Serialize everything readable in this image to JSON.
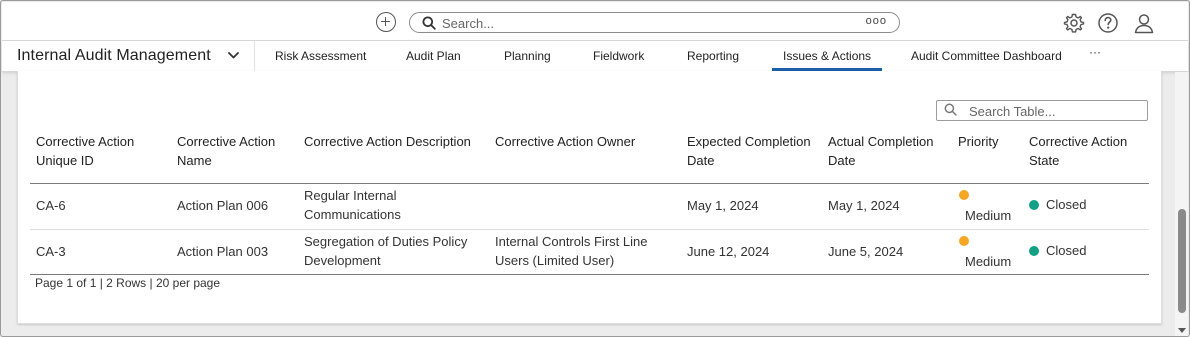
{
  "global_search": {
    "placeholder": "Search...",
    "more": "ooo"
  },
  "nav": {
    "app_name": "Internal Audit Management",
    "tabs": [
      {
        "label": "Risk Assessment"
      },
      {
        "label": "Audit Plan"
      },
      {
        "label": "Planning"
      },
      {
        "label": "Fieldwork"
      },
      {
        "label": "Reporting"
      },
      {
        "label": "Issues & Actions",
        "active": true
      },
      {
        "label": "Audit Committee Dashboard"
      }
    ],
    "more": "···"
  },
  "table": {
    "search_placeholder": "Search Table...",
    "headers": [
      "Corrective Action\nUnique ID",
      "Corrective Action\nName",
      "Corrective Action Description",
      "Corrective Action Owner",
      "Expected Completion\nDate",
      "Actual Completion\nDate",
      "Priority",
      "Corrective Action\nState"
    ],
    "rows": [
      {
        "id": "CA-6",
        "name": "Action Plan 006",
        "description": "Regular Internal\nCommunications",
        "owner": "",
        "expected": "May 1, 2024",
        "actual": "May 1, 2024",
        "priority": "Medium",
        "state": "Closed"
      },
      {
        "id": "CA-3",
        "name": "Action Plan 003",
        "description": "Segregation of Duties Policy\nDevelopment",
        "owner": "Internal Controls First Line\nUsers (Limited User)",
        "expected": "June 12, 2024",
        "actual": "June 5, 2024",
        "priority": "Medium",
        "state": "Closed"
      }
    ],
    "pager": "Page 1 of 1 | 2 Rows | 20 per page"
  },
  "colors": {
    "priority_medium": "#f5a623",
    "state_closed": "#14a085",
    "active_tab": "#1a5fa8"
  },
  "icons": {
    "add": "add-circle-icon",
    "search": "search-icon",
    "settings": "gear-icon",
    "help": "help-icon",
    "user": "user-icon",
    "app_menu": "chevron-down-icon"
  }
}
